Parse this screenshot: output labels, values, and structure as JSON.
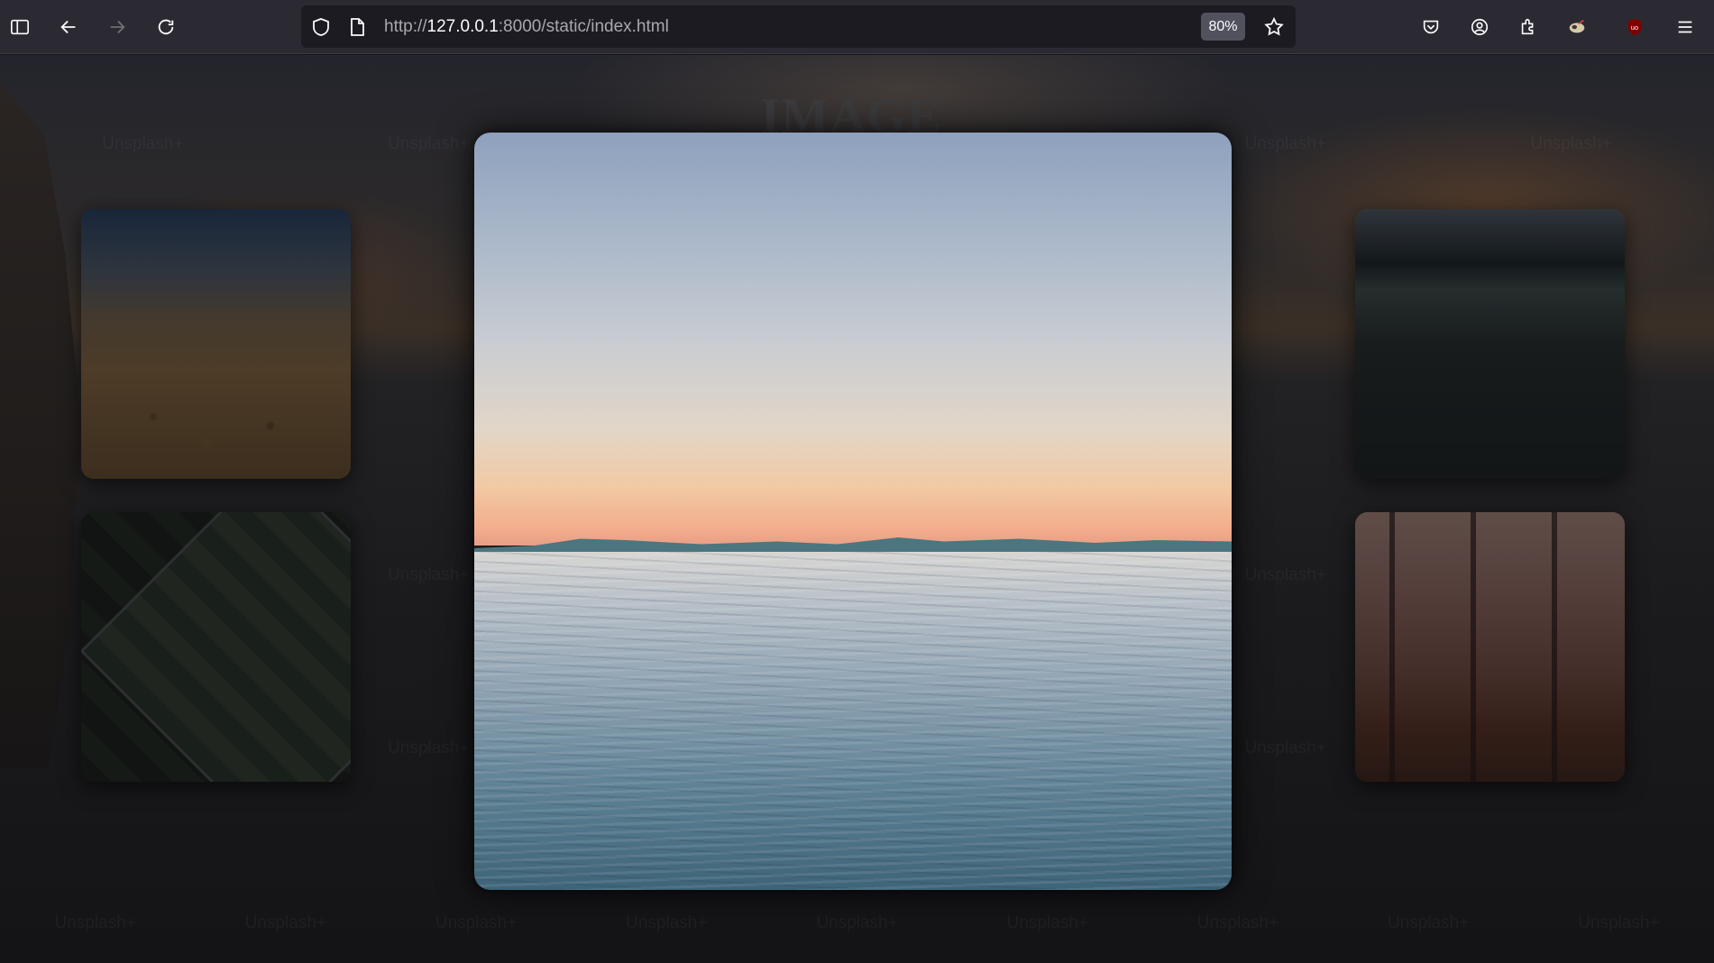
{
  "browser": {
    "url_scheme": "http://",
    "url_host": "127.0.0.1",
    "url_path": ":8000/static/index.html",
    "zoom": "80%",
    "icons": [
      "sidebar-icon",
      "back-icon",
      "forward-icon",
      "reload-icon",
      "shield-icon",
      "page-icon",
      "bookmark-star-icon",
      "pocket-icon",
      "account-icon",
      "extensions-icon",
      "extension-icon",
      "ublock-icon",
      "menu-icon"
    ]
  },
  "page": {
    "title": "IMAGE GALLERY",
    "watermark": "Unsplash+",
    "thumbnails": [
      "beach-pebbles",
      "football-field",
      "frosty-meadow",
      "misty-forest"
    ],
    "featured_image": "lake-sunset"
  }
}
